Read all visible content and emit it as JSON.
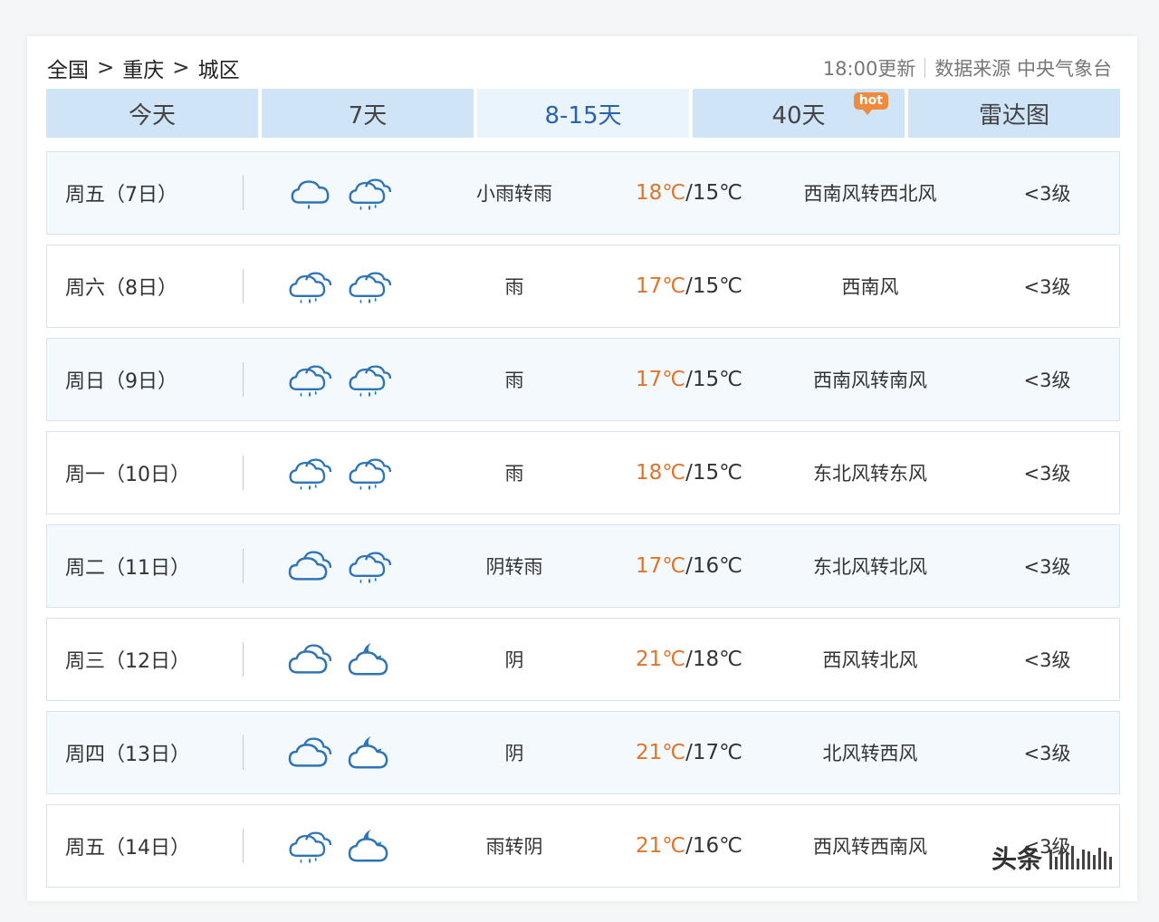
{
  "breadcrumb": [
    "全国",
    "重庆",
    "城区"
  ],
  "breadcrumb_sep": ">",
  "update_time": "18:00更新",
  "data_source": "数据来源 中央气象台",
  "tabs": [
    {
      "label": "今天"
    },
    {
      "label": "7天"
    },
    {
      "label": "8-15天"
    },
    {
      "label": "40天",
      "badge": "hot"
    },
    {
      "label": "雷达图"
    }
  ],
  "active_tab": "8-15天",
  "colors": {
    "high_temp": "#e0742a",
    "active_tab_text": "#2a63a8",
    "tab_bg": "#cfe4f7",
    "icon_blue": "#2f74b5"
  },
  "forecast": [
    {
      "day": "周五（7日）",
      "icons": [
        "light-rain-icon",
        "rain-icon"
      ],
      "condition": "小雨转雨",
      "high": "18℃",
      "low": "15℃",
      "wind": "西南风转西北风",
      "level": "<3级"
    },
    {
      "day": "周六（8日）",
      "icons": [
        "rain-icon",
        "rain-icon"
      ],
      "condition": "雨",
      "high": "17℃",
      "low": "15℃",
      "wind": "西南风",
      "level": "<3级"
    },
    {
      "day": "周日（9日）",
      "icons": [
        "rain-icon",
        "rain-icon"
      ],
      "condition": "雨",
      "high": "17℃",
      "low": "15℃",
      "wind": "西南风转南风",
      "level": "<3级"
    },
    {
      "day": "周一（10日）",
      "icons": [
        "rain-icon",
        "rain-icon"
      ],
      "condition": "雨",
      "high": "18℃",
      "low": "15℃",
      "wind": "东北风转东风",
      "level": "<3级"
    },
    {
      "day": "周二（11日）",
      "icons": [
        "overcast-icon",
        "rain-icon"
      ],
      "condition": "阴转雨",
      "high": "17℃",
      "low": "16℃",
      "wind": "东北风转北风",
      "level": "<3级"
    },
    {
      "day": "周三（12日）",
      "icons": [
        "overcast-icon",
        "cloudy-night-icon"
      ],
      "condition": "阴",
      "high": "21℃",
      "low": "18℃",
      "wind": "西风转北风",
      "level": "<3级"
    },
    {
      "day": "周四（13日）",
      "icons": [
        "overcast-icon",
        "cloudy-night-icon"
      ],
      "condition": "阴",
      "high": "21℃",
      "low": "17℃",
      "wind": "北风转西风",
      "level": "<3级"
    },
    {
      "day": "周五（14日）",
      "icons": [
        "rain-icon",
        "cloudy-night-icon"
      ],
      "condition": "雨转阴",
      "high": "21℃",
      "low": "16℃",
      "wind": "西风转西南风",
      "level": "<3级"
    }
  ],
  "watermark": "头条"
}
